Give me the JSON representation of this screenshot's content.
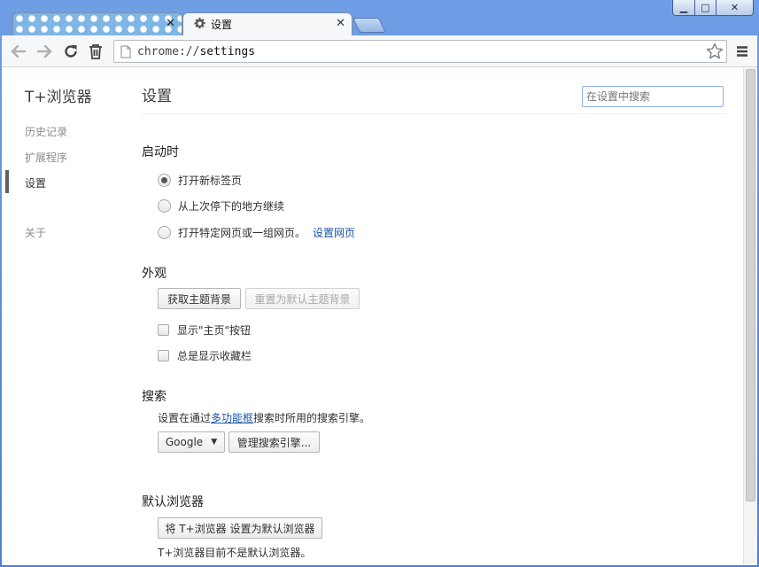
{
  "window": {
    "minimize_glyph": "▁",
    "maximize_glyph": "□",
    "close_glyph": "✕"
  },
  "tabs": [
    {
      "label": "",
      "close": "✕",
      "icon": "polka-dot-theme"
    },
    {
      "label": "设置",
      "close": "✕",
      "icon": "gear-icon"
    }
  ],
  "toolbar": {
    "back_icon": "back-arrow-icon",
    "forward_icon": "forward-arrow-icon",
    "reload_icon": "reload-icon",
    "trash_icon": "trash-icon",
    "url_scheme": "chrome://",
    "url_host": "settings",
    "star_icon": "star-icon",
    "menu_icon": "hamburger-menu-icon"
  },
  "sidebar": {
    "title": "T+浏览器",
    "items": [
      {
        "label": "历史记录",
        "active": false
      },
      {
        "label": "扩展程序",
        "active": false
      },
      {
        "label": "设置",
        "active": true
      },
      {
        "label": "关于",
        "active": false
      }
    ]
  },
  "main": {
    "title": "设置",
    "search_placeholder": "在设置中搜索",
    "startup": {
      "title": "启动时",
      "options": [
        {
          "label": "打开新标签页",
          "selected": true
        },
        {
          "label": "从上次停下的地方继续",
          "selected": false
        },
        {
          "label": "打开特定网页或一组网页。",
          "selected": false
        }
      ],
      "set_pages_link": "设置网页"
    },
    "appearance": {
      "title": "外观",
      "get_themes_button": "获取主题背景",
      "reset_theme_button": "重置为默认主题背景",
      "show_home_button": "显示\"主页\"按钮",
      "show_bookmarks_bar": "总是显示收藏栏"
    },
    "search": {
      "title": "搜索",
      "desc_before": "设置在通过",
      "desc_link": "多功能框",
      "desc_after": "搜索时所用的搜索引擎。",
      "engine_selected": "Google",
      "manage_button": "管理搜索引擎..."
    },
    "default_browser": {
      "title": "默认浏览器",
      "set_default_button": "将 T+浏览器 设置为默认浏览器",
      "status_text": "T+浏览器目前不是默认浏览器。"
    }
  },
  "colors": {
    "accent_link": "#1a56a8",
    "frame_blue": "#5f8fd8",
    "search_border": "#8bb1e6"
  }
}
